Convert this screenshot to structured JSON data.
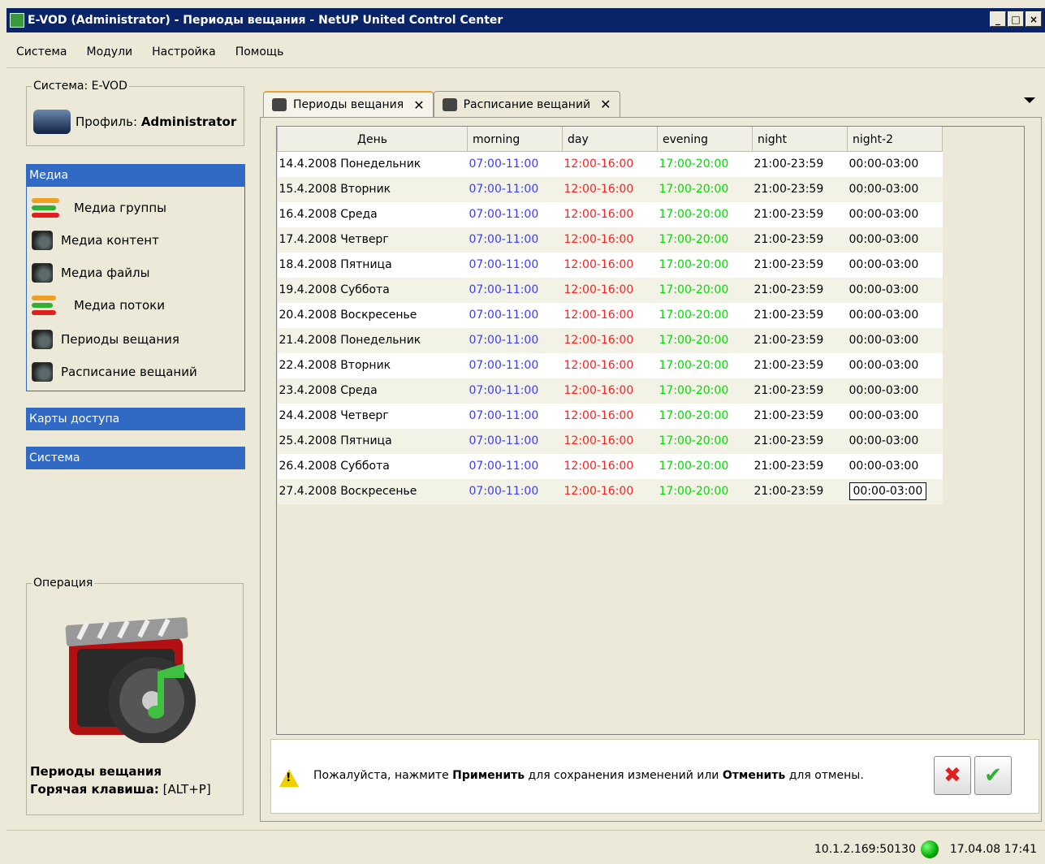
{
  "window": {
    "title": "E-VOD (Administrator) - Периоды вещания - NetUP United Control Center",
    "minimize": "_",
    "maximize": "□",
    "close": "×"
  },
  "menu": [
    "Система",
    "Модули",
    "Настройка",
    "Помощь"
  ],
  "sidebar": {
    "system_legend": "Система: E-VOD",
    "profile_prefix": "Профиль:",
    "profile_name": "Administrator",
    "sections": {
      "media": "Медиа",
      "access_cards": "Карты доступа",
      "system": "Система"
    },
    "media_items": [
      {
        "label": "Медиа группы",
        "icon": "arrows-icon"
      },
      {
        "label": "Медиа контент",
        "icon": "camera-icon"
      },
      {
        "label": "Медиа файлы",
        "icon": "camera-icon"
      },
      {
        "label": "Медиа потоки",
        "icon": "arrows-icon"
      },
      {
        "label": "Периоды вещания",
        "icon": "camera-icon"
      },
      {
        "label": "Расписание вещаний",
        "icon": "camera-icon"
      }
    ],
    "operation": {
      "legend": "Операция",
      "title": "Периоды вещания",
      "hotkey_label": "Горячая клавиша:",
      "hotkey_value": "[ALT+P]"
    }
  },
  "tabs": [
    {
      "label": "Периоды вещания",
      "active": true
    },
    {
      "label": "Расписание вещаний",
      "active": false
    }
  ],
  "table": {
    "columns": [
      "День",
      "morning",
      "day",
      "evening",
      "night",
      "night-2"
    ],
    "rows": [
      [
        "14.4.2008 Понедельник",
        "07:00-11:00",
        "12:00-16:00",
        "17:00-20:00",
        "21:00-23:59",
        "00:00-03:00"
      ],
      [
        "15.4.2008 Вторник",
        "07:00-11:00",
        "12:00-16:00",
        "17:00-20:00",
        "21:00-23:59",
        "00:00-03:00"
      ],
      [
        "16.4.2008 Среда",
        "07:00-11:00",
        "12:00-16:00",
        "17:00-20:00",
        "21:00-23:59",
        "00:00-03:00"
      ],
      [
        "17.4.2008 Четверг",
        "07:00-11:00",
        "12:00-16:00",
        "17:00-20:00",
        "21:00-23:59",
        "00:00-03:00"
      ],
      [
        "18.4.2008 Пятница",
        "07:00-11:00",
        "12:00-16:00",
        "17:00-20:00",
        "21:00-23:59",
        "00:00-03:00"
      ],
      [
        "19.4.2008 Суббота",
        "07:00-11:00",
        "12:00-16:00",
        "17:00-20:00",
        "21:00-23:59",
        "00:00-03:00"
      ],
      [
        "20.4.2008 Воскресенье",
        "07:00-11:00",
        "12:00-16:00",
        "17:00-20:00",
        "21:00-23:59",
        "00:00-03:00"
      ],
      [
        "21.4.2008 Понедельник",
        "07:00-11:00",
        "12:00-16:00",
        "17:00-20:00",
        "21:00-23:59",
        "00:00-03:00"
      ],
      [
        "22.4.2008 Вторник",
        "07:00-11:00",
        "12:00-16:00",
        "17:00-20:00",
        "21:00-23:59",
        "00:00-03:00"
      ],
      [
        "23.4.2008 Среда",
        "07:00-11:00",
        "12:00-16:00",
        "17:00-20:00",
        "21:00-23:59",
        "00:00-03:00"
      ],
      [
        "24.4.2008 Четверг",
        "07:00-11:00",
        "12:00-16:00",
        "17:00-20:00",
        "21:00-23:59",
        "00:00-03:00"
      ],
      [
        "25.4.2008 Пятница",
        "07:00-11:00",
        "12:00-16:00",
        "17:00-20:00",
        "21:00-23:59",
        "00:00-03:00"
      ],
      [
        "26.4.2008 Суббота",
        "07:00-11:00",
        "12:00-16:00",
        "17:00-20:00",
        "21:00-23:59",
        "00:00-03:00"
      ],
      [
        "27.4.2008 Воскресенье",
        "07:00-11:00",
        "12:00-16:00",
        "17:00-20:00",
        "21:00-23:59",
        "00:00-03:00"
      ]
    ],
    "colors": {
      "morning": "#3c3cff",
      "day": "#ff2020",
      "evening": "#00dd00"
    }
  },
  "message": {
    "prefix": "Пожалуйста, нажмите ",
    "apply_word": "Применить",
    "middle": " для сохранения изменений или ",
    "cancel_word": "Отменить",
    "suffix": " для отмены."
  },
  "status": {
    "address": "10.1.2.169:50130",
    "datetime": "17.04.08 17:41"
  }
}
